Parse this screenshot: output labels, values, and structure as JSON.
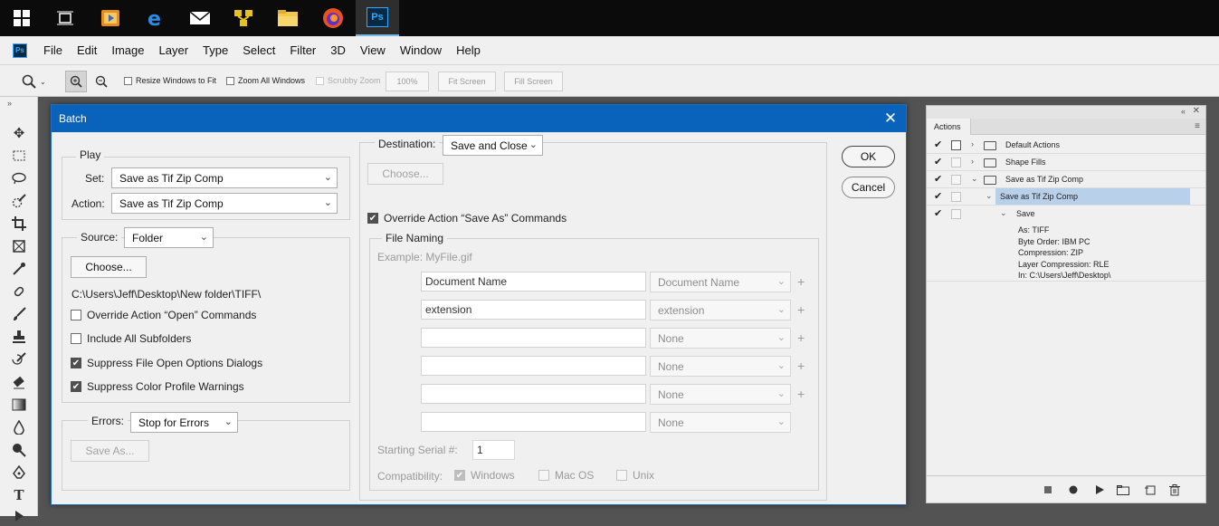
{
  "taskbar": {
    "icons": [
      "windows-start-icon",
      "task-view-icon",
      "media-player-icon",
      "edge-icon",
      "mail-icon",
      "network-app-icon",
      "file-explorer-icon",
      "firefox-icon",
      "photoshop-icon"
    ],
    "ps_label": "Ps"
  },
  "menubar": {
    "logo": "Ps",
    "items": [
      "File",
      "Edit",
      "Image",
      "Layer",
      "Type",
      "Select",
      "Filter",
      "3D",
      "View",
      "Window",
      "Help"
    ]
  },
  "options": {
    "resize_windows": "Resize Windows to Fit",
    "zoom_all": "Zoom All Windows",
    "scrubby_zoom": "Scrubby Zoom",
    "zoom_value": "100%",
    "fit_screen": "Fit Screen",
    "fill_screen": "Fill Screen"
  },
  "dialog": {
    "title": "Batch",
    "close": "✕",
    "play": {
      "label": "Play",
      "set_label": "Set:",
      "set_value": "Save as Tif Zip Comp",
      "action_label": "Action:",
      "action_value": "Save as Tif Zip Comp"
    },
    "source": {
      "label": "Source:",
      "value": "Folder",
      "choose": "Choose...",
      "path": "C:\\Users\\Jeff\\Desktop\\New folder\\TIFF\\",
      "override_open": "Override Action “Open” Commands",
      "include_subfolders": "Include All Subfolders",
      "suppress_open": "Suppress File Open Options Dialogs",
      "suppress_color": "Suppress Color Profile Warnings"
    },
    "errors": {
      "label": "Errors:",
      "value": "Stop for Errors",
      "save_as": "Save As..."
    },
    "destination": {
      "label": "Destination:",
      "value": "Save and Close",
      "choose": "Choose...",
      "override_save": "Override Action “Save As” Commands",
      "file_naming": "File Naming",
      "example": "Example: MyFile.gif",
      "rows": [
        {
          "text": "Document Name",
          "select": "Document Name",
          "plus": "+"
        },
        {
          "text": "extension",
          "select": "extension",
          "plus": "+"
        },
        {
          "text": "",
          "select": "None",
          "plus": "+"
        },
        {
          "text": "",
          "select": "None",
          "plus": "+"
        },
        {
          "text": "",
          "select": "None",
          "plus": "+"
        },
        {
          "text": "",
          "select": "None",
          "plus": ""
        }
      ],
      "serial_label": "Starting Serial #:",
      "serial_value": "1",
      "compat_label": "Compatibility:",
      "windows": "Windows",
      "macos": "Mac OS",
      "unix": "Unix"
    },
    "ok": "OK",
    "cancel": "Cancel"
  },
  "actions_panel": {
    "tab": "Actions",
    "rows": [
      {
        "name": "Default Actions"
      },
      {
        "name": "Shape Fills"
      },
      {
        "name": "Save as Tif Zip Comp"
      },
      {
        "name": "Save as Tif Zip Comp"
      },
      {
        "name": "Save"
      }
    ],
    "details": [
      "As: TIFF",
      "Byte Order: IBM PC",
      "Compression: ZIP",
      "Layer Compression: RLE",
      "In: C:\\Users\\Jeff\\Desktop\\"
    ]
  }
}
